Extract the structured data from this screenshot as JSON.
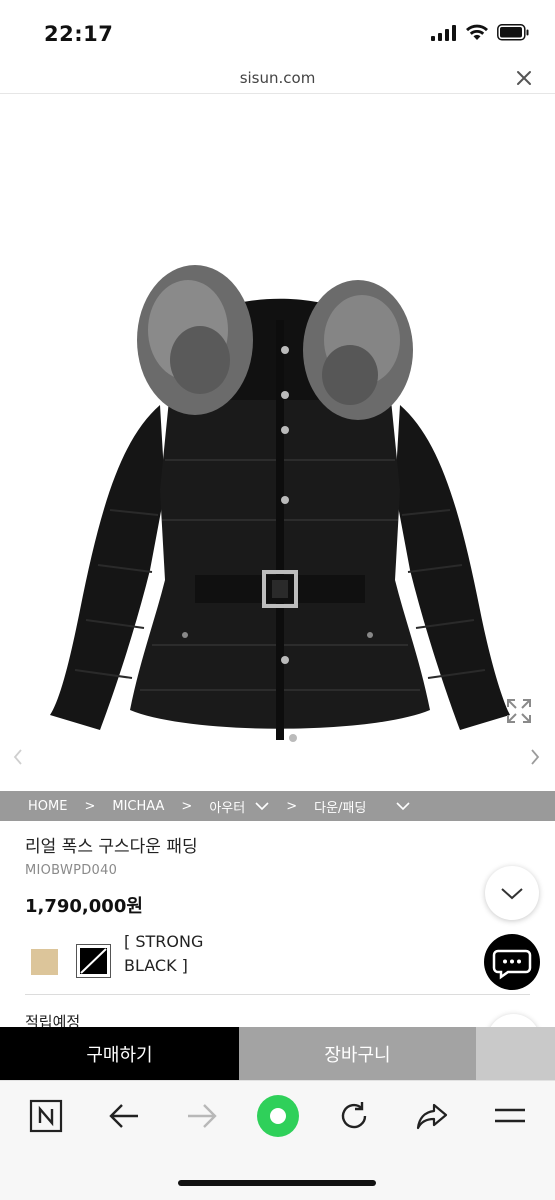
{
  "status": {
    "time": "22:17"
  },
  "browser": {
    "url": "sisun.com"
  },
  "breadcrumb": {
    "items": [
      "HOME",
      "MICHAA",
      "아우터",
      "다운/패딩"
    ],
    "separator": ">"
  },
  "product": {
    "name": "리얼 폭스 구스다운 패딩",
    "code": "MIOBWPD040",
    "price": "1,790,000원",
    "selected_color_line1": "[ STRONG",
    "selected_color_line2": "BLACK ]",
    "swatches": [
      "#dcc59a",
      "#000000"
    ],
    "points_label": "적립예정"
  },
  "actions": {
    "buy_label": "구매하기",
    "cart_label": "장바구니"
  },
  "icons": {
    "url_close": "close-icon",
    "expand": "expand-icon",
    "prev": "chevron-left-icon",
    "next": "chevron-right-icon",
    "scroll_down": "chevron-down-icon",
    "chat": "chat-bubble-icon",
    "top": "arrow-up-icon",
    "toolbar": [
      "naver-n-icon",
      "back-arrow-icon",
      "forward-arrow-icon",
      "green-dot-icon",
      "refresh-icon",
      "share-icon",
      "menu-icon"
    ]
  },
  "colors": {
    "breadcrumb_bg": "#9a9a9a",
    "buy_bg": "#000000",
    "cart_bg": "#a3a3a3",
    "accent_green": "#2fd05a"
  }
}
